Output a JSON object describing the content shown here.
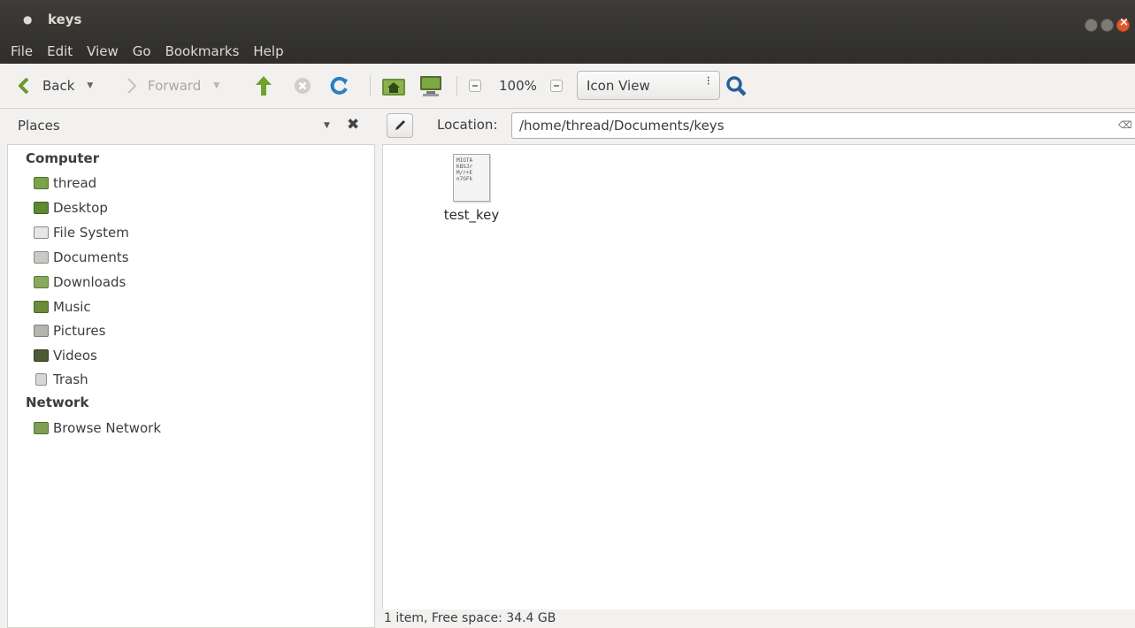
{
  "window": {
    "title": "keys"
  },
  "menubar": [
    "File",
    "Edit",
    "View",
    "Go",
    "Bookmarks",
    "Help"
  ],
  "toolbar": {
    "back_label": "Back",
    "forward_label": "Forward",
    "zoom_level": "100%",
    "view_mode": "Icon View"
  },
  "places": {
    "title": "Places"
  },
  "location": {
    "label": "Location:",
    "path": "/home/thread/Documents/keys"
  },
  "sidebar": {
    "sections": [
      {
        "heading": "Computer",
        "items": [
          {
            "label": "thread",
            "icon": "home-folder-icon"
          },
          {
            "label": "Desktop",
            "icon": "desktop-icon"
          },
          {
            "label": "File System",
            "icon": "drive-icon"
          },
          {
            "label": "Documents",
            "icon": "documents-folder-icon"
          },
          {
            "label": "Downloads",
            "icon": "downloads-folder-icon"
          },
          {
            "label": "Music",
            "icon": "music-folder-icon"
          },
          {
            "label": "Pictures",
            "icon": "pictures-folder-icon"
          },
          {
            "label": "Videos",
            "icon": "videos-folder-icon"
          },
          {
            "label": "Trash",
            "icon": "trash-icon"
          }
        ]
      },
      {
        "heading": "Network",
        "items": [
          {
            "label": "Browse Network",
            "icon": "network-icon"
          }
        ]
      }
    ]
  },
  "files": [
    {
      "name": "test_key",
      "preview_text": "MIGTA\nKBSJr\nM/r+E\nn7GFk",
      "icon": "text-file-icon"
    }
  ],
  "status": "1 item, Free space: 34.4 GB"
}
